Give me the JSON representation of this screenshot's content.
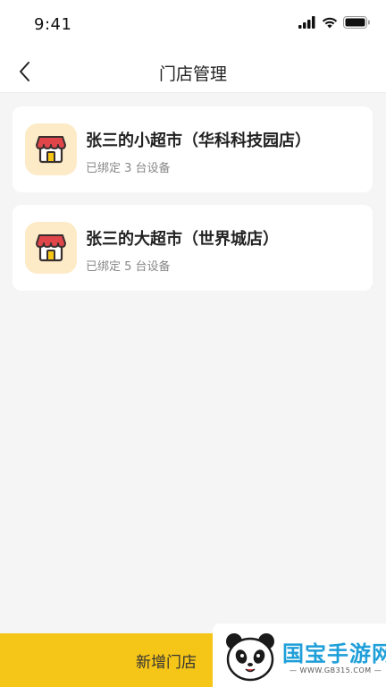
{
  "status_bar": {
    "time": "9:41"
  },
  "nav": {
    "title": "门店管理"
  },
  "stores": [
    {
      "name": "张三的小超市（华科科技园店）",
      "desc": "已绑定 3 台设备"
    },
    {
      "name": "张三的大超市（世界城店）",
      "desc": "已绑定 5 台设备"
    }
  ],
  "bottom": {
    "label": "新增门店"
  },
  "watermark": {
    "text": "国宝手游网",
    "url": "— WWW.GB315.COM —"
  },
  "colors": {
    "accent": "#f5c518",
    "background": "#f5f5f5",
    "icon_bg": "#fdebc8",
    "awning": "#e0454a"
  }
}
